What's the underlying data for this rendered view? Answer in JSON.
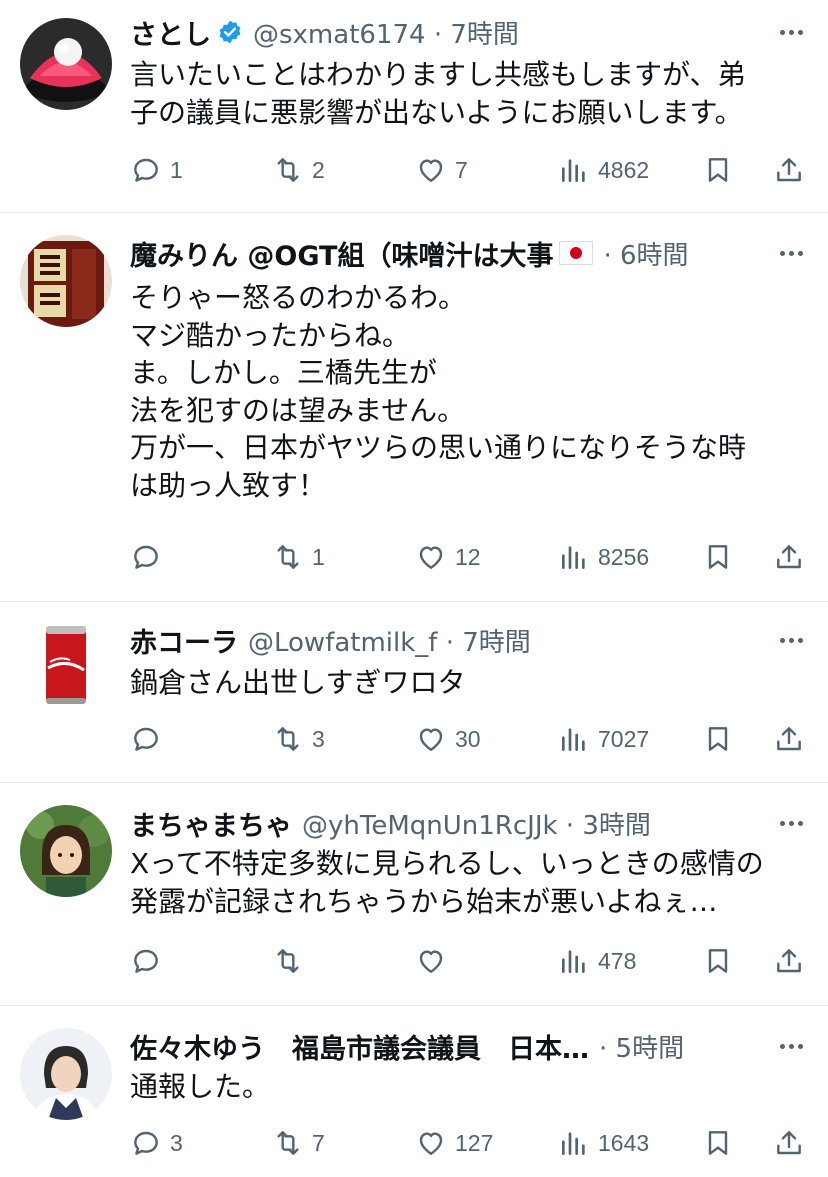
{
  "tweets": [
    {
      "name": "さとし",
      "verified": true,
      "handle_time": "@sxmat6174 · 7時間",
      "text": "言いたいことはわかりますし共感もしますが、弟\n子の議員に悪影響が出ないようにお願いします。",
      "reply_count": "1",
      "retweet_count": "2",
      "like_count": "7",
      "view_count": "4862"
    },
    {
      "name": "魔みりん @OGT組（味噌汁は大事",
      "flag": true,
      "handle_time": "· 6時間",
      "text": "そりゃー怒るのわかるわ。\nマジ酷かったからね。\nま。しかし。三橋先生が\n法を犯すのは望みません。\n万が一、日本がヤツらの思い通りになりそうな時\nは助っ人致す！",
      "reply_count": "",
      "retweet_count": "1",
      "like_count": "12",
      "view_count": "8256"
    },
    {
      "name": "赤コーラ",
      "handle_time": "@Lowfatmilk_f · 7時間",
      "text": "鍋倉さん出世しすぎワロタ",
      "reply_count": "",
      "retweet_count": "3",
      "like_count": "30",
      "view_count": "7027"
    },
    {
      "name": "まちゃまちゃ",
      "handle_time": "@yhTeMqnUn1RcJJk · 3時間",
      "text": "Xって不特定多数に見られるし、いっときの感情の\n発露が記録されちゃうから始末が悪いよねぇ…",
      "reply_count": "",
      "retweet_count": "",
      "like_count": "",
      "view_count": "478"
    },
    {
      "name": "佐々木ゆう　福島市議会議員　日本…",
      "handle_time": "· 5時間",
      "text": "通報した。",
      "reply_count": "3",
      "retweet_count": "7",
      "like_count": "127",
      "view_count": "1643"
    }
  ],
  "icons": {
    "reply": "speech-bubble-icon",
    "retweet": "repost-arrows-icon",
    "like": "heart-icon",
    "views": "bar-chart-icon",
    "bookmark": "bookmark-icon",
    "share": "share-upload-icon",
    "verified": "verified-badge-icon",
    "more": "more-dots-icon"
  },
  "colors": {
    "text": "#0f1419",
    "secondary": "#536471",
    "verified": "#1d9bf0",
    "divider": "#e7e9eb"
  }
}
